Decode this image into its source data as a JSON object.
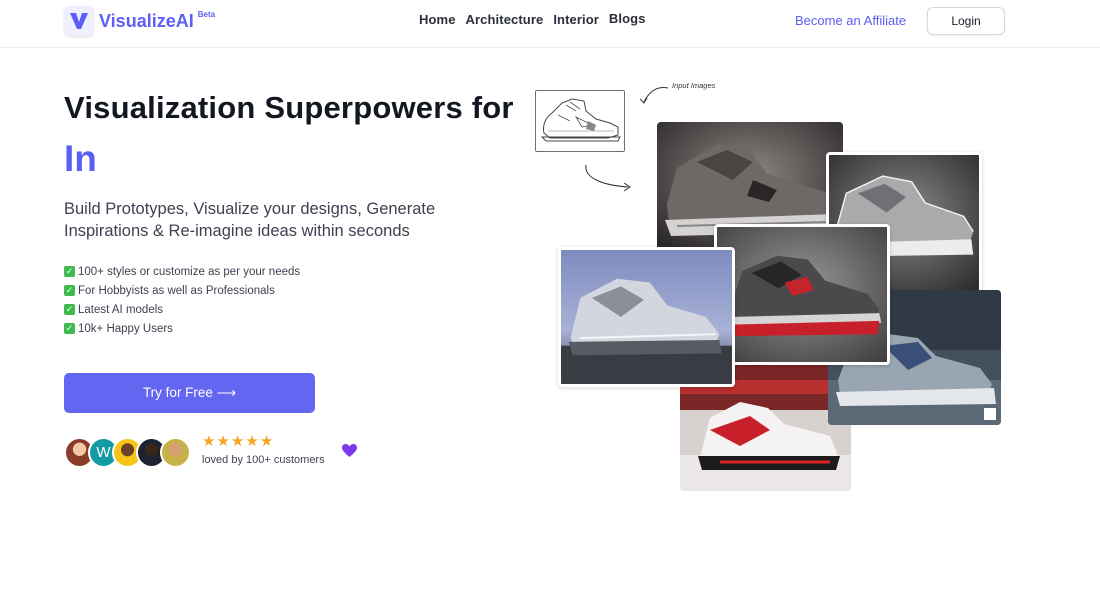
{
  "brand": {
    "name": "VisualizeAI",
    "badge": "Beta",
    "accent_color": "#5b5ff5"
  },
  "nav": {
    "links": [
      {
        "label": "Home"
      },
      {
        "label": "Architecture"
      },
      {
        "label": "Interior"
      },
      {
        "label": "Blogs"
      }
    ],
    "affiliate_label": "Become an Affiliate",
    "login_label": "Login"
  },
  "hero": {
    "headline": "Visualization Superpowers for",
    "headline_accent": "In",
    "subheadline": "Build Prototypes, Visualize your designs, Generate Inspirations & Re-imagine ideas within seconds",
    "features": [
      {
        "icon": "check-icon",
        "text": "100+ styles or customize as per your needs"
      },
      {
        "icon": "check-icon",
        "text": "For Hobbyists as well as Professionals"
      },
      {
        "icon": "check-icon",
        "text": "Latest AI models"
      },
      {
        "icon": "check-icon",
        "text": "10k+ Happy Users"
      }
    ],
    "cta_label": "Try for Free ⟶",
    "rating_stars": 5,
    "social_proof": "loved by 100+ customers",
    "avatar_initial": "W"
  },
  "collage": {
    "input_label": "Input Images"
  }
}
